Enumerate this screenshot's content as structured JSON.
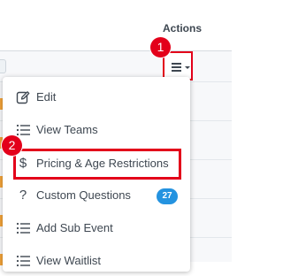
{
  "table": {
    "actions_header": "Actions"
  },
  "trigger": {
    "icon": "hamburger-menu-icon"
  },
  "annotations": {
    "step1": "1",
    "step2": "2",
    "highlight_color": "#e3001a"
  },
  "menu": {
    "items": [
      {
        "label": "Edit",
        "icon": "edit-icon"
      },
      {
        "label": "View Teams",
        "icon": "list-icon"
      },
      {
        "label": "Pricing & Age Restrictions",
        "icon": "dollar-icon"
      },
      {
        "label": "Custom Questions",
        "icon": "question-icon",
        "badge": "27"
      },
      {
        "label": "Add Sub Event",
        "icon": "list-icon"
      },
      {
        "label": "View Waitlist",
        "icon": "list-icon"
      }
    ],
    "badge_color": "#2493e0"
  }
}
